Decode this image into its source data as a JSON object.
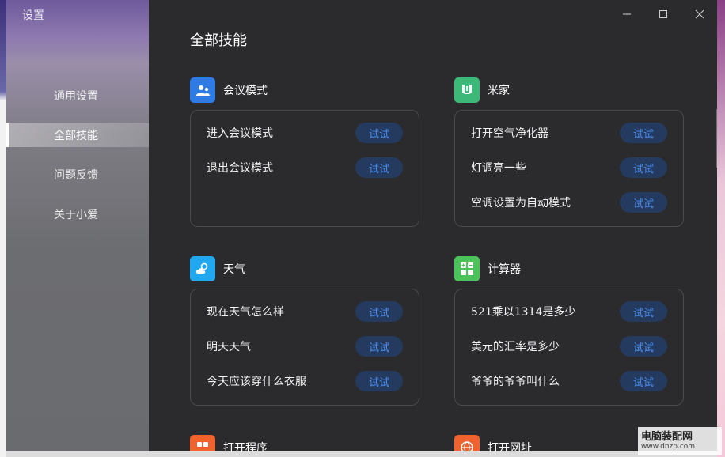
{
  "window": {
    "title": "设置"
  },
  "sidebar": {
    "items": [
      {
        "label": "通用设置"
      },
      {
        "label": "全部技能"
      },
      {
        "label": "问题反馈"
      },
      {
        "label": "关于小爱"
      }
    ],
    "active_index": 1
  },
  "main": {
    "title": "全部技能",
    "try_label": "试试",
    "skills": [
      {
        "name": "会议模式",
        "icon": "meeting-icon",
        "color": "#2f7be6",
        "commands": [
          "进入会议模式",
          "退出会议模式"
        ]
      },
      {
        "name": "米家",
        "icon": "mijia-icon",
        "color": "#3cb878",
        "commands": [
          "打开空气净化器",
          "灯调亮一些",
          "空调设置为自动模式"
        ]
      },
      {
        "name": "天气",
        "icon": "weather-icon",
        "color": "#22a8f0",
        "commands": [
          "现在天气怎么样",
          "明天天气",
          "今天应该穿什么衣服"
        ]
      },
      {
        "name": "计算器",
        "icon": "calculator-icon",
        "color": "#4cc35a",
        "commands": [
          "521乘以1314是多少",
          "美元的汇率是多少",
          "爷爷的爷爷叫什么"
        ]
      },
      {
        "name": "打开程序",
        "icon": "apps-icon",
        "color": "#f0622e"
      },
      {
        "name": "打开网址",
        "icon": "globe-icon",
        "color": "#f0622e"
      }
    ]
  },
  "watermark": {
    "line1": "电脑装配网",
    "line2": "www.dnzp.com"
  }
}
